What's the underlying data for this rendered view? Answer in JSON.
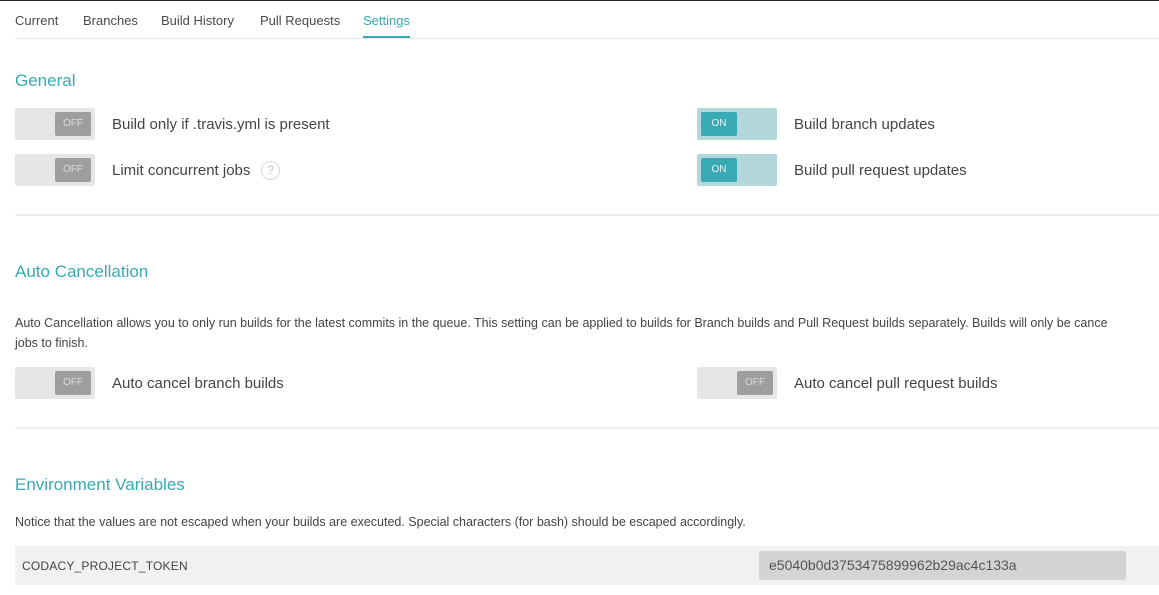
{
  "tabs": [
    {
      "label": "Current"
    },
    {
      "label": "Branches"
    },
    {
      "label": "Build History"
    },
    {
      "label": "Pull Requests"
    },
    {
      "label": "Settings"
    }
  ],
  "active_tab": "Settings",
  "general": {
    "title": "General",
    "settings": [
      {
        "label": "Build only if .travis.yml is present",
        "state": "OFF"
      },
      {
        "label": "Limit concurrent jobs",
        "state": "OFF",
        "help": "?"
      },
      {
        "label": "Build branch updates",
        "state": "ON"
      },
      {
        "label": "Build pull request updates",
        "state": "ON"
      }
    ]
  },
  "auto_cancellation": {
    "title": "Auto Cancellation",
    "description_line1": "Auto Cancellation allows you to only run builds for the latest commits in the queue. This setting can be applied to builds for Branch builds and Pull Request builds separately. Builds will only be cance",
    "description_line2": "jobs to finish.",
    "settings": [
      {
        "label": "Auto cancel branch builds",
        "state": "OFF"
      },
      {
        "label": "Auto cancel pull request builds",
        "state": "OFF"
      }
    ]
  },
  "environment_variables": {
    "title": "Environment Variables",
    "notice": "Notice that the values are not escaped when your builds are executed. Special characters (for bash) should be escaped accordingly.",
    "variables": [
      {
        "name": "CODACY_PROJECT_TOKEN",
        "value": "e5040b0d3753475899962b29ac4c133a"
      }
    ]
  },
  "colors": {
    "accent": "#39a9b3",
    "toggle_off": "#9e9e9e",
    "toggle_on_track": "#b3d8dc"
  }
}
